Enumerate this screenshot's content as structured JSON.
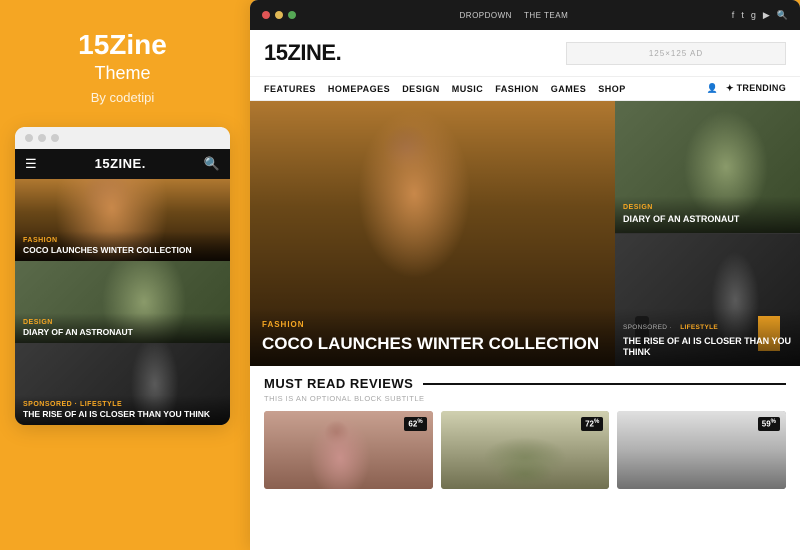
{
  "left": {
    "brand": "15Zine",
    "subtitle": "Theme",
    "byline": "By codetipi",
    "dots": [
      "dot1",
      "dot2",
      "dot3"
    ],
    "mockup": {
      "nav_title": "15ZINE.",
      "cards": [
        {
          "category": "FASHION",
          "title": "COCO LAUNCHES WINTER COLLECTION"
        },
        {
          "category": "DESIGN",
          "title": "DIARY OF AN ASTRONAUT"
        },
        {
          "category": "SPONSORED · LIFESTYLE",
          "title": "THE RISE OF AI IS CLOSER THAN YOU THINK"
        }
      ]
    }
  },
  "main": {
    "top_bar": {
      "links": [
        "DROPDOWN",
        "THE TEAM"
      ],
      "icons": [
        "f",
        "t",
        "g+",
        "▶",
        "🔍"
      ]
    },
    "logo": "15ZINE.",
    "ad_placeholder": "125×125 AD",
    "nav": {
      "links": [
        "FEATURES",
        "HOMEPAGES",
        "DESIGN",
        "MUSIC",
        "FASHION",
        "GAMES",
        "SHOP"
      ],
      "right": "✦ TRENDING"
    },
    "hero": {
      "main": {
        "category": "FASHION",
        "title": "COCO LAUNCHES WINTER COLLECTION"
      },
      "side_top": {
        "category": "DESIGN",
        "title": "DIARY OF AN ASTRONAUT"
      },
      "side_bottom": {
        "sponsored_label": "SPONSORED · LIFESTYLE",
        "title": "THE RISE OF AI IS CLOSER THAN YOU THINK"
      }
    },
    "must_read": {
      "title": "MUST READ REVIEWS",
      "subtitle": "THIS IS AN OPTIONAL BLOCK SUBTITLE",
      "cards": [
        {
          "score": "62",
          "unit": "%"
        },
        {
          "score": "72",
          "unit": "%"
        },
        {
          "score": "59",
          "unit": "%"
        }
      ]
    }
  }
}
